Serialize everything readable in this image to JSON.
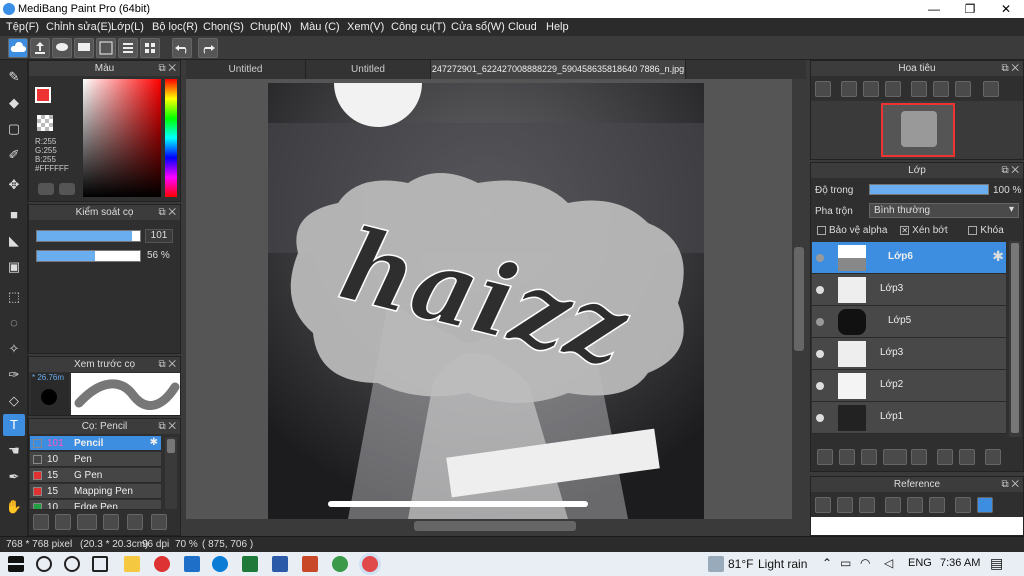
{
  "window": {
    "title": "MediBang Paint Pro (64bit)",
    "minimize": "—",
    "restore": "❐",
    "close": "✕"
  },
  "menu": [
    "Tệp(F)",
    "Chỉnh sửa(E)",
    "Lớp(L)",
    "Bộ lọc(R)",
    "Chọn(S)",
    "Chụp(N)",
    "Màu (C)",
    "Xem(V)",
    "Công cụ(T)",
    "Cửa sổ(W)",
    "Cloud",
    "Help"
  ],
  "color_panel": {
    "title": "Màu",
    "r": "R:255",
    "g": "G:255",
    "b": "B:255",
    "hex": "#FFFFFF"
  },
  "brush_control": {
    "title": "Kiểm soát cọ",
    "size_value": "101",
    "opacity_value": "56 %",
    "size_fraction": 0.92,
    "opacity_fraction": 0.56
  },
  "brush_preview": {
    "title": "Xem trước cọ",
    "size_label": "* 26.76m"
  },
  "brush_list": {
    "title": "Cọ: Pencil",
    "items": [
      {
        "size": "101",
        "name": "Pencil",
        "color": "#3d8ee0"
      },
      {
        "size": "10",
        "name": "Pen",
        "color": "#444444"
      },
      {
        "size": "15",
        "name": "G Pen",
        "color": "#e03030"
      },
      {
        "size": "15",
        "name": "Mapping Pen",
        "color": "#e03030"
      },
      {
        "size": "10",
        "name": "Edge Pen",
        "color": "#20a040"
      }
    ]
  },
  "tabs": [
    "Untitled",
    "Untitled",
    "247272901_622427008888229_590458635818640 7886_n.jpg"
  ],
  "canvas": {
    "text": "haizz"
  },
  "navigator": {
    "title": "Hoa tiêu"
  },
  "layer_panel": {
    "title": "Lớp",
    "opacity_label": "Độ trong",
    "opacity_value": "100 %",
    "opacity_fraction": 1.0,
    "blend_label": "Pha trộn",
    "blend_value": "Bình thường",
    "protect_alpha": "Bảo vệ alpha",
    "clipping": "Xén bớt",
    "lock": "Khóa",
    "layers": [
      "Lớp6",
      "Lớp3",
      "Lớp5",
      "Lớp3",
      "Lớp2",
      "Lớp1"
    ]
  },
  "reference": {
    "title": "Reference"
  },
  "status": {
    "size": "768 * 768 pixel",
    "cm": "(20.3 * 20.3cm)",
    "dpi": "96 dpi",
    "zoom": "70 %",
    "coords": "( 875, 706 )"
  },
  "taskbar": {
    "weather_temp": "81°F",
    "weather_desc": "Light rain",
    "lang": "ENG",
    "time": "7:36 AM"
  },
  "colors": {
    "accent": "#3d8ee0",
    "panel_bg": "#2f2f2f"
  }
}
